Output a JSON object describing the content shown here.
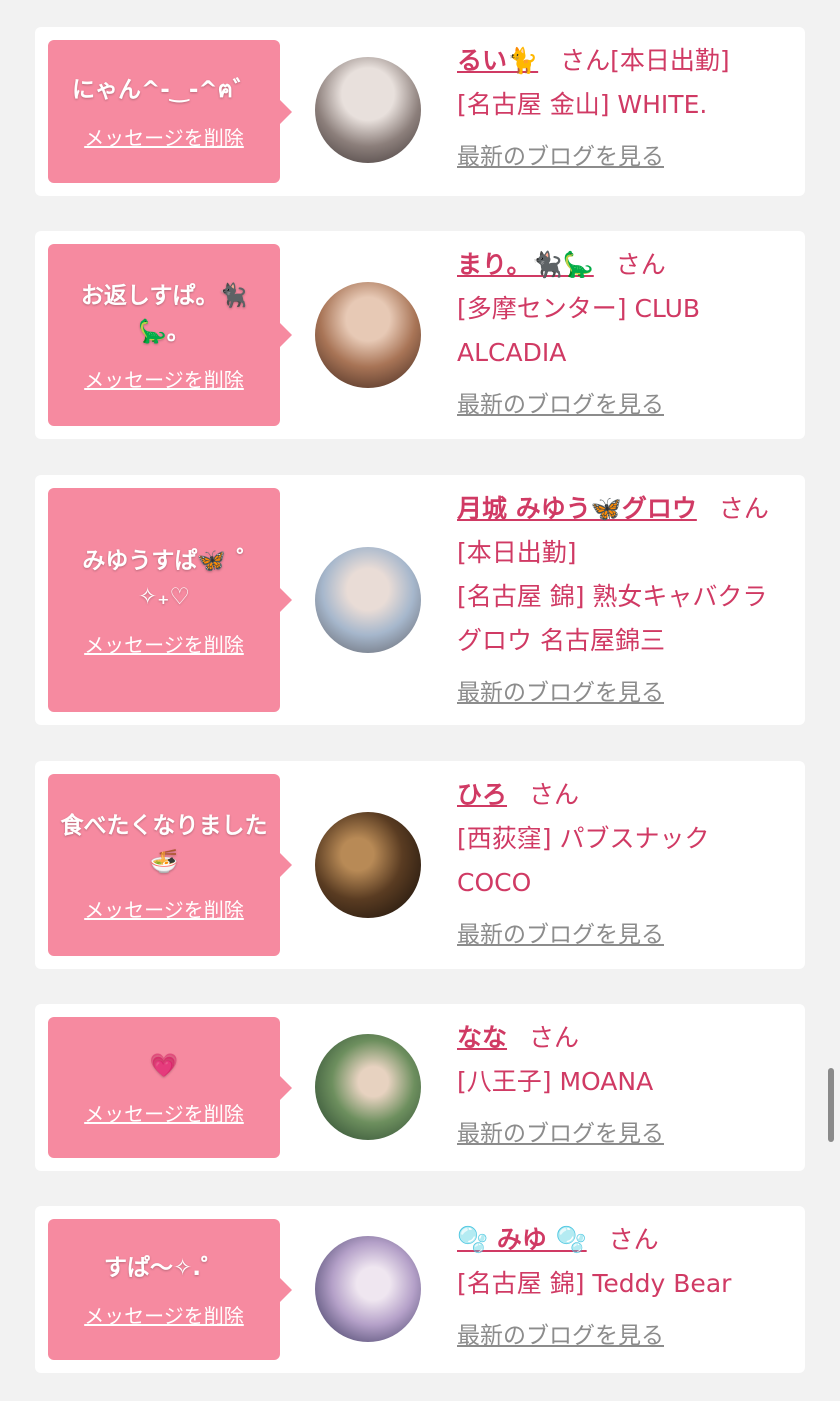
{
  "cards": [
    {
      "message": "にゃん^-‿-^ฅ゛",
      "delete_label": "メッセージを削除",
      "name": "るい🐈",
      "suffix": "さん",
      "status": "[本日出勤]",
      "shop": "[名古屋 金山] WHITE.",
      "blog_label": "最新のブログを見る",
      "avatar_colors": [
        "#d9d3d0",
        "#4a3f3e"
      ]
    },
    {
      "message": "お返しすぱ。🐈‍⬛🦕。",
      "delete_label": "メッセージを削除",
      "name": "まり。🐈‍⬛🦕",
      "suffix": "さん",
      "status": "",
      "shop": "[多摩センター] CLUB ALCADIA",
      "blog_label": "最新のブログを見る",
      "avatar_colors": [
        "#c9a38b",
        "#3b241c"
      ]
    },
    {
      "message": "みゆうすぱ🦋 ˚ ✧₊♡",
      "delete_label": "メッセージを削除",
      "name": "月城 みゆう🦋グロウ",
      "suffix": "さん",
      "status": "[本日出勤]",
      "shop": "[名古屋 錦] 熟女キャバクラグロウ 名古屋錦三",
      "blog_label": "最新のブログを見る",
      "avatar_colors": [
        "#b9c6d6",
        "#5b4a48"
      ]
    },
    {
      "message": "食べたくなりました🍜",
      "delete_label": "メッセージを削除",
      "name": "ひろ",
      "suffix": "さん",
      "status": "",
      "shop": "[西荻窪] パブスナック COCO",
      "blog_label": "最新のブログを見る",
      "avatar_colors": [
        "#6b4a2a",
        "#1a120c"
      ]
    },
    {
      "message": "💗",
      "delete_label": "メッセージを削除",
      "name": "なな",
      "suffix": "さん",
      "status": "",
      "shop": "[八王子] MOANA",
      "blog_label": "最新のブログを見る",
      "avatar_colors": [
        "#4f7a4a",
        "#23402a"
      ]
    },
    {
      "message": "すぱ〜✧.゜",
      "delete_label": "メッセージを削除",
      "name": "🫧 みゆ 🫧",
      "suffix": "さん",
      "status": "",
      "shop": "[名古屋 錦] Teddy Bear",
      "blog_label": "最新のブログを見る",
      "avatar_colors": [
        "#c7b8d6",
        "#2a2a52"
      ]
    }
  ]
}
